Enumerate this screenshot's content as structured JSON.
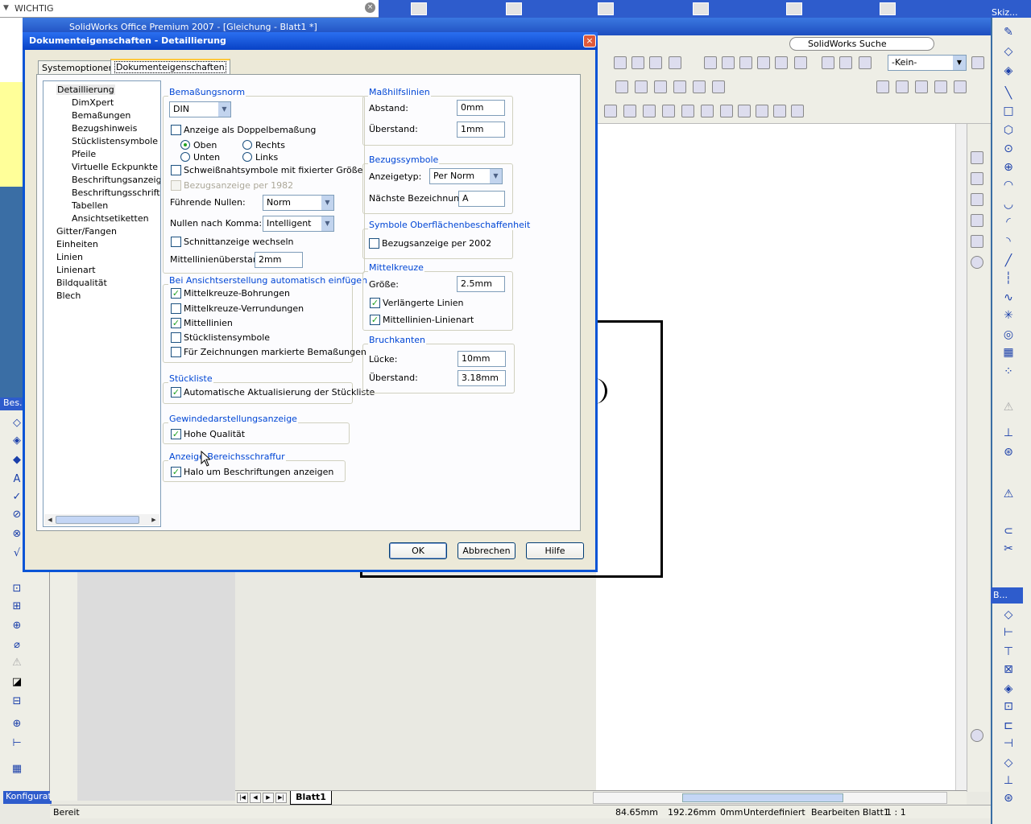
{
  "top_search": {
    "text": "WICHTIG"
  },
  "app": {
    "title": "SolidWorks Office Premium 2007 - [Gleichung - Blatt1 *]",
    "search_label": "SolidWorks Suche",
    "config_select": "-Kein-",
    "skizze_panel": "Skiz...",
    "b_panel": "B...",
    "left_panel": "Bes.",
    "konfig_label": "Konfiguratio"
  },
  "dialog": {
    "title": "Dokumenteigenschaften - Detaillierung",
    "tabs": [
      {
        "label": "Systemoptionen",
        "active": false
      },
      {
        "label": "Dokumenteigenschaften",
        "active": true
      }
    ],
    "tree": [
      {
        "label": "Detaillierung",
        "selected": true
      },
      {
        "label": "DimXpert"
      },
      {
        "label": "Bemaßungen"
      },
      {
        "label": "Bezugshinweis"
      },
      {
        "label": "Stücklistensymbole"
      },
      {
        "label": "Pfeile"
      },
      {
        "label": "Virtuelle Eckpunkte"
      },
      {
        "label": "Beschriftungsanzeige"
      },
      {
        "label": "Beschriftungsschriftart"
      },
      {
        "label": "Tabellen"
      },
      {
        "label": "Ansichtsetiketten"
      },
      {
        "label": "Gitter/Fangen"
      },
      {
        "label": "Einheiten"
      },
      {
        "label": "Linien"
      },
      {
        "label": "Linienart"
      },
      {
        "label": "Bildqualität"
      },
      {
        "label": "Blech"
      }
    ],
    "bemassungsnorm": {
      "title": "Bemaßungsnorm",
      "norm": "DIN",
      "doppel": "Anzeige als Doppelbemaßung",
      "oben": "Oben",
      "unten": "Unten",
      "rechts": "Rechts",
      "links": "Links",
      "schweiss": "Schweißnahtsymbole mit fixierter Größe",
      "bezug1982": "Bezugsanzeige per 1982",
      "fuehrende_label": "Führende Nullen:",
      "fuehrende_value": "Norm",
      "nullen_label": "Nullen nach Komma:",
      "nullen_value": "Intelligent",
      "schnitt": "Schnittanzeige wechseln",
      "mittel_label": "Mittellinienüberstand:",
      "mittel_value": "2mm"
    },
    "ansicht": {
      "title": "Bei Ansichtserstellung automatisch einfügen",
      "items": [
        {
          "label": "Mittelkreuze-Bohrungen",
          "checked": true
        },
        {
          "label": "Mittelkreuze-Verrundungen",
          "checked": false
        },
        {
          "label": "Mittellinien",
          "checked": true
        },
        {
          "label": "Stücklistensymbole",
          "checked": false
        },
        {
          "label": "Für Zeichnungen markierte Bemaßungen",
          "checked": false
        }
      ]
    },
    "stueckliste": {
      "title": "Stückliste",
      "auto": "Automatische Aktualisierung der Stückliste"
    },
    "gewinde": {
      "title": "Gewindedarstellungsanzeige",
      "hohe": "Hohe Qualität"
    },
    "bereich": {
      "title": "Anzeige Bereichsschraffur",
      "halo": "Halo um Beschriftungen anzeigen"
    },
    "masshilf": {
      "title": "Maßhilfslinien",
      "abstand_label": "Abstand:",
      "abstand": "0mm",
      "ueber_label": "Überstand:",
      "ueber": "1mm"
    },
    "bezugssymbole": {
      "title": "Bezugssymbole",
      "typ_label": "Anzeigetyp:",
      "typ": "Per Norm",
      "next_label": "Nächste Bezeichnung:",
      "next": "A"
    },
    "oberflaeche": {
      "title": "Symbole Oberflächenbeschaffenheit",
      "bezug2002": "Bezugsanzeige per 2002"
    },
    "mittelkreuze": {
      "title": "Mittelkreuze",
      "groesse_label": "Größe:",
      "groesse": "2.5mm",
      "verl": "Verlängerte Linien",
      "linienart": "Mittellinien-Linienart"
    },
    "bruchkanten": {
      "title": "Bruchkanten",
      "luecke_label": "Lücke:",
      "luecke": "10mm",
      "ueber_label": "Überstand:",
      "ueber": "3.18mm"
    },
    "buttons": {
      "ok": "OK",
      "cancel": "Abbrechen",
      "help": "Hilfe"
    }
  },
  "sheet_tab": "Blatt1",
  "status": {
    "ready": "Bereit",
    "x": "84.65mm",
    "y": "192.26mm",
    "z": "0mm",
    "state": "Unterdefiniert",
    "edit": "Bearbeiten Blatt1",
    "scale": "1 : 1"
  },
  "colors": {
    "accent": "#0046d5",
    "titlebar": "#0842c6",
    "check": "#21a121"
  }
}
